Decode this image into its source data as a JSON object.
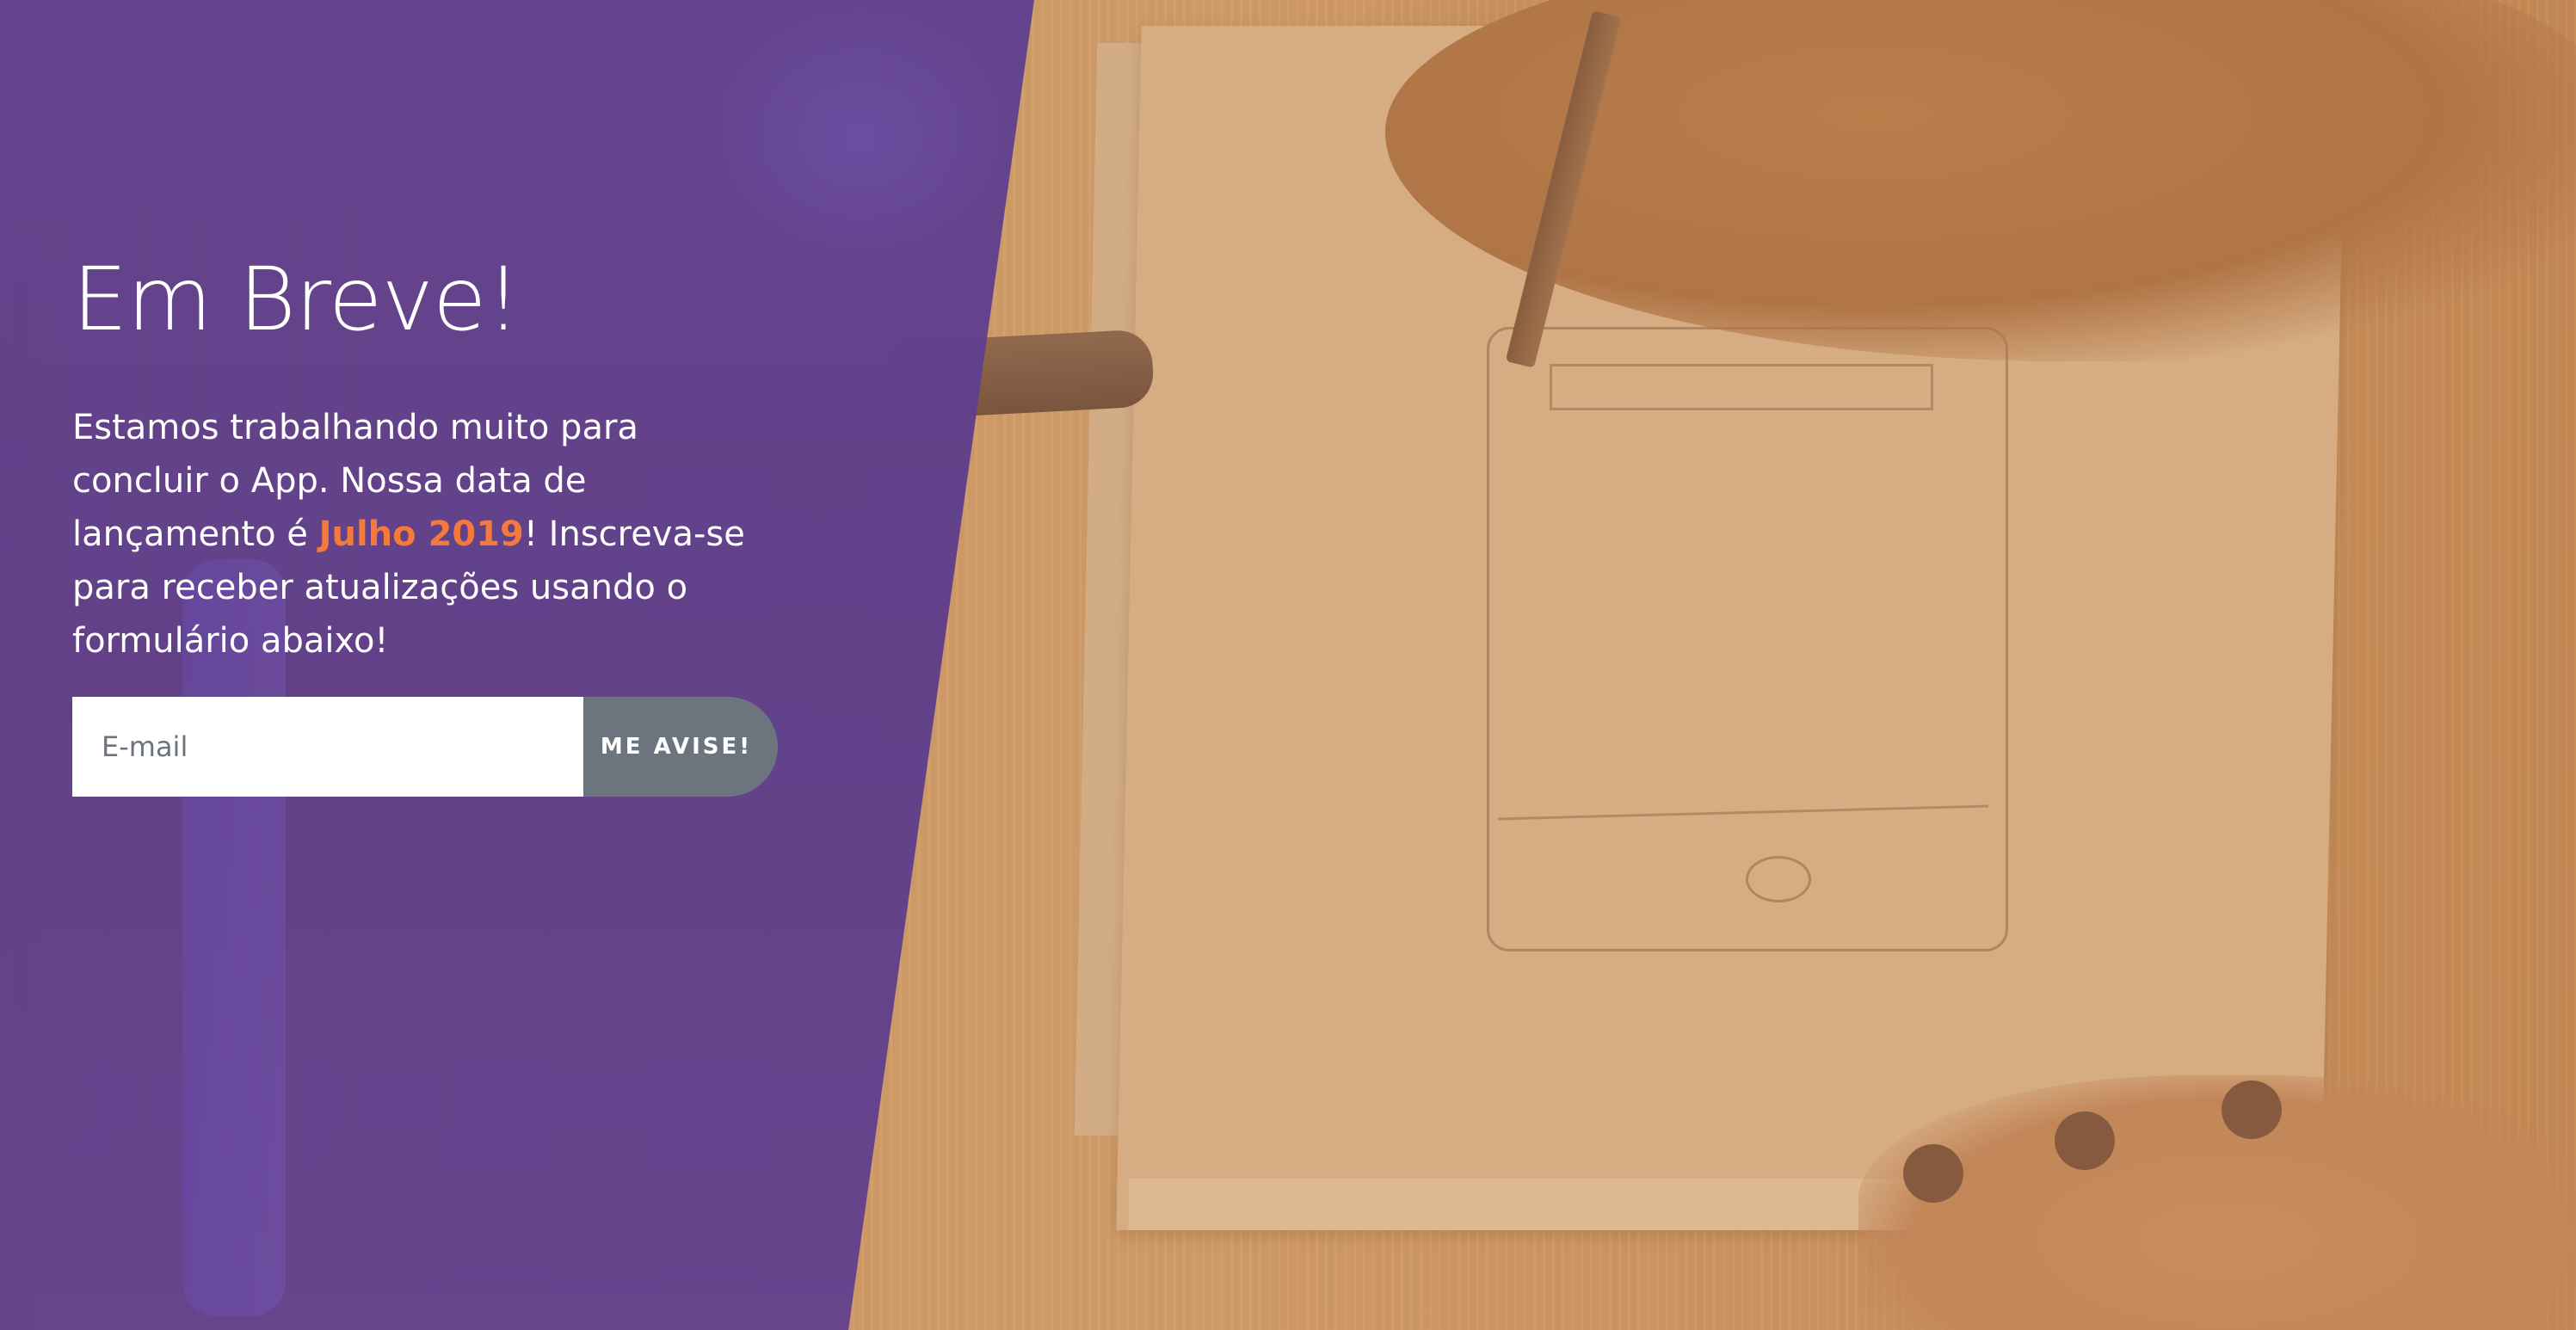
{
  "hero": {
    "title": "Em Breve!",
    "description_before": "Estamos trabalhando muito para concluir o App. Nossa data de lançamento é ",
    "description_highlight": "Julho 2019",
    "description_after": "! Inscreva-se para receber atualizações usando o formulário abaixo!"
  },
  "signup_form": {
    "email_placeholder": "E-mail",
    "email_value": "",
    "submit_label": "ME AVISE!"
  },
  "colors": {
    "panel_purple": "#5e3d8a",
    "highlight_orange": "#f5793a",
    "button_gray": "#6c757d"
  }
}
